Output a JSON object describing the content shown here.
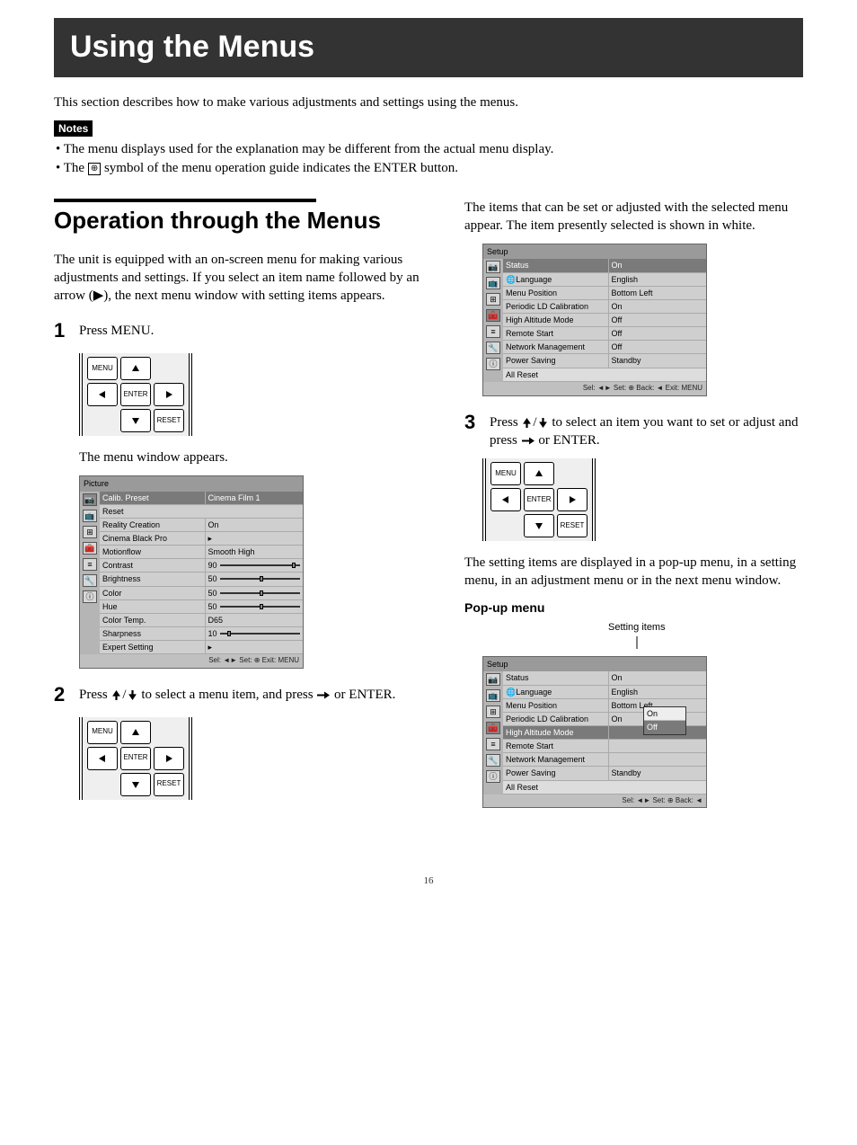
{
  "title": "Using the Menus",
  "intro": "This section describes how to make various adjustments and settings using the menus.",
  "notes_label": "Notes",
  "notes": [
    "The menu displays used for the explanation may be different from the actual menu display.",
    "The ⊕ symbol of the menu operation guide indicates the ENTER button."
  ],
  "section": {
    "heading": "Operation through the Menus",
    "body": "The unit is equipped with an on-screen menu for making various adjustments and settings. If you select an item name followed by an arrow (▶), the next menu window with setting items appears."
  },
  "steps": {
    "s1": {
      "num": "1",
      "text": "Press MENU.",
      "after": "The menu window appears."
    },
    "s2": {
      "num": "2",
      "text_a": "Press ",
      "text_b": " to select a menu item, and press ",
      "text_c": " or ENTER."
    },
    "s2_right_pre": "The items that can be set or adjusted with the selected menu appear. The item presently selected is shown in white.",
    "s3": {
      "num": "3",
      "text_a": "Press ",
      "text_b": " to select an item you want to set or adjust and press ",
      "text_c": " or ENTER."
    },
    "s3_after": "The setting items are displayed in a pop-up menu, in a setting menu, in an adjustment menu or in the next menu window.",
    "popup_heading": "Pop-up menu",
    "setting_items_label": "Setting items"
  },
  "remote": {
    "menu": "MENU",
    "enter": "ENTER",
    "reset": "RESET"
  },
  "osd_picture": {
    "title": "Picture",
    "rows": [
      {
        "l": "Calib. Preset",
        "r": "Cinema Film 1",
        "sel": true
      },
      {
        "l": "Reset",
        "span": true
      },
      {
        "l": "Reality Creation",
        "r": "On"
      },
      {
        "l": "Cinema Black Pro",
        "r": "▸"
      },
      {
        "l": "Motionflow",
        "r": "Smooth High"
      },
      {
        "l": "Contrast",
        "r": "90",
        "slider": 0.9
      },
      {
        "l": "Brightness",
        "r": "50",
        "slider": 0.5
      },
      {
        "l": "Color",
        "r": "50",
        "slider": 0.5
      },
      {
        "l": "Hue",
        "r": "50",
        "slider": 0.5
      },
      {
        "l": "Color Temp.",
        "r": "D65"
      },
      {
        "l": "Sharpness",
        "r": "10",
        "slider": 0.1
      },
      {
        "l": "Expert Setting",
        "r": "▸"
      }
    ],
    "footer": "Sel: ◄► Set: ⊕ Exit: MENU"
  },
  "osd_setup": {
    "title": "Setup",
    "rows": [
      {
        "l": "Status",
        "r": "On",
        "sel": true
      },
      {
        "l": "🌐Language",
        "r": "English"
      },
      {
        "l": "Menu Position",
        "r": "Bottom Left"
      },
      {
        "l": "Periodic LD Calibration",
        "r": "On"
      },
      {
        "l": "High Altitude Mode",
        "r": "Off"
      },
      {
        "l": "Remote Start",
        "r": "Off"
      },
      {
        "l": "Network Management",
        "r": "Off"
      },
      {
        "l": "Power Saving",
        "r": "Standby"
      },
      {
        "l": "All Reset",
        "span": true,
        "sel2": true
      }
    ],
    "footer": "Sel: ◄► Set: ⊕ Back: ◄ Exit: MENU"
  },
  "osd_popup": {
    "title": "Setup",
    "rows": [
      {
        "l": "Status",
        "r": "On"
      },
      {
        "l": "🌐Language",
        "r": "English"
      },
      {
        "l": "Menu Position",
        "r": "Bottom Left"
      },
      {
        "l": "Periodic LD Calibration",
        "r": "On"
      },
      {
        "l": "High Altitude Mode",
        "r": "",
        "sel": true
      },
      {
        "l": "Remote Start",
        "r": ""
      },
      {
        "l": "Network Management",
        "r": ""
      },
      {
        "l": "Power Saving",
        "r": "Standby"
      },
      {
        "l": "All Reset",
        "span": true,
        "sel2": true
      }
    ],
    "popup_options": [
      {
        "t": "On"
      },
      {
        "t": "Off",
        "sel": true
      }
    ],
    "footer": "Sel: ◄► Set: ⊕ Back: ◄"
  },
  "page_number": "16"
}
